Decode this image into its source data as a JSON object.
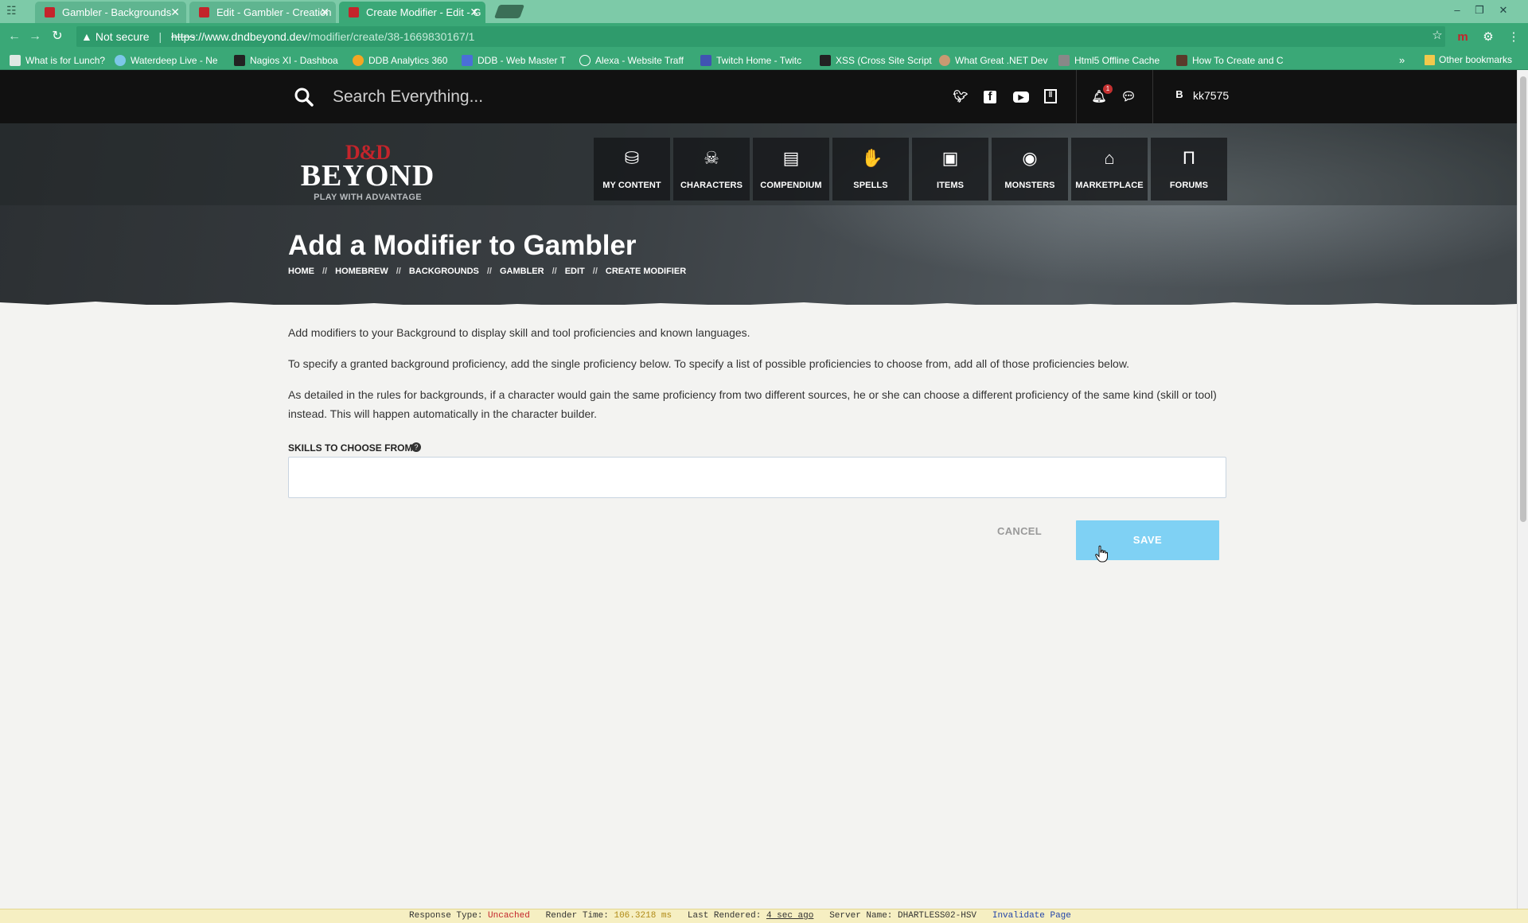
{
  "browser": {
    "tabs": [
      {
        "title": "Gambler - Backgrounds",
        "active": false
      },
      {
        "title": "Edit - Gambler - Creation",
        "active": false
      },
      {
        "title": "Create Modifier - Edit - G",
        "active": true
      }
    ],
    "window_controls": {
      "minimize": "–",
      "restore": "❐",
      "close": "✕"
    },
    "address": {
      "security_label": "Not secure",
      "scheme": "https",
      "host": "://www.dndbeyond.dev",
      "path": "/modifier/create/38-1669830167/1"
    },
    "bookmarks": [
      "What is for Lunch?",
      "Waterdeep Live - Ne",
      "Nagios XI - Dashboa",
      "DDB Analytics 360",
      "DDB - Web Master T",
      "Alexa - Website Traff",
      "Twitch Home - Twitc",
      "XSS (Cross Site Script",
      "What Great .NET Dev",
      "Html5 Offline Cache",
      "How To Create and C"
    ],
    "bookmarks_overflow": "»",
    "other_bookmarks": "Other bookmarks"
  },
  "site": {
    "search_placeholder": "Search Everything...",
    "notification_count": "1",
    "user_initial": "B",
    "username": "kk7575",
    "logo": {
      "dnd": "D&D",
      "beyond": "BEYOND",
      "tagline": "PLAY WITH ADVANTAGE"
    },
    "nav": [
      {
        "label": "MY CONTENT",
        "icon": "bag-icon",
        "glyph": "⛁"
      },
      {
        "label": "CHARACTERS",
        "icon": "helmet-icon",
        "glyph": "☠"
      },
      {
        "label": "COMPENDIUM",
        "icon": "book-icon",
        "glyph": "▤"
      },
      {
        "label": "SPELLS",
        "icon": "hand-icon",
        "glyph": "✋"
      },
      {
        "label": "ITEMS",
        "icon": "chest-icon",
        "glyph": "▣"
      },
      {
        "label": "MONSTERS",
        "icon": "monster-icon",
        "glyph": "◉"
      },
      {
        "label": "MARKETPLACE",
        "icon": "store-icon",
        "glyph": "⌂"
      },
      {
        "label": "FORUMS",
        "icon": "column-icon",
        "glyph": "Π"
      }
    ]
  },
  "page": {
    "title": "Add a Modifier to Gambler",
    "breadcrumb": [
      "HOME",
      "HOMEBREW",
      "BACKGROUNDS",
      "GAMBLER",
      "EDIT",
      "CREATE MODIFIER"
    ],
    "breadcrumb_separator": "//",
    "paragraphs": [
      "Add modifiers to your Background to display skill and tool proficiencies and known languages.",
      "To specify a granted background proficiency, add the single proficiency below. To specify a list of possible proficiencies to choose from, add all of those proficiencies below.",
      "As detailed in the rules for backgrounds, if a character would gain the same proficiency from two different sources, he or she can choose a different proficiency of the same kind (skill or tool) instead. This will happen automatically in the character builder."
    ],
    "skills_label": "SKILLS TO CHOOSE FROM.",
    "skills_value": "",
    "cancel_label": "CANCEL",
    "save_label": "SAVE"
  },
  "debug": {
    "response_type_label": "Response Type:",
    "response_type": "Uncached",
    "render_time_label": "Render Time:",
    "render_time": "106.3218 ms",
    "last_rendered_label": "Last Rendered:",
    "last_rendered": "4 sec ago",
    "server_name_label": "Server Name:",
    "server_name": "DHARTLESS02-HSV",
    "invalidate": "Invalidate Page"
  },
  "colors": {
    "accent": "#7fd1f4",
    "brand_red": "#c4242b",
    "chrome_green": "#3aa877"
  }
}
